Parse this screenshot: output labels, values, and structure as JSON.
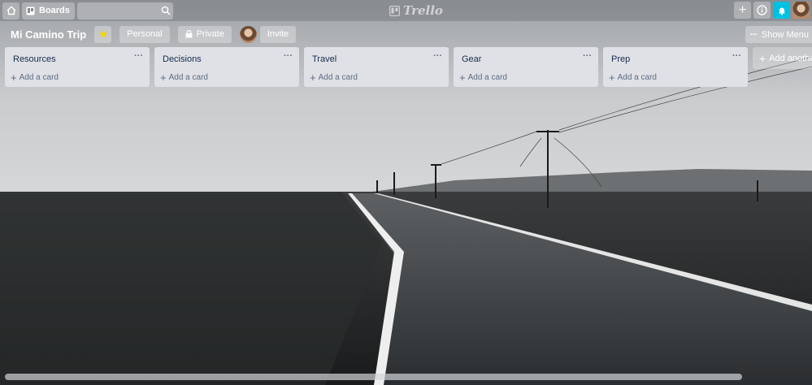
{
  "header": {
    "boards_label": "Boards",
    "search_placeholder": "",
    "logo_text": "Trello",
    "colors": {
      "notif": "#00c2e0"
    },
    "icons": [
      "home-icon",
      "boards-icon",
      "search-icon",
      "plus-icon",
      "info-icon",
      "bell-icon"
    ]
  },
  "board": {
    "title": "Mi Camino Trip",
    "visibility_team": "Personal",
    "visibility_privacy": "Private",
    "invite_label": "Invite",
    "show_menu_label": "Show Menu",
    "star_color": "#f2d600"
  },
  "lists": [
    {
      "title": "Resources",
      "add_card": "Add a card"
    },
    {
      "title": "Decisions",
      "add_card": "Add a card"
    },
    {
      "title": "Travel",
      "add_card": "Add a card"
    },
    {
      "title": "Gear",
      "add_card": "Add a card"
    },
    {
      "title": "Prep",
      "add_card": "Add a card"
    }
  ],
  "add_list_label": "Add another list"
}
